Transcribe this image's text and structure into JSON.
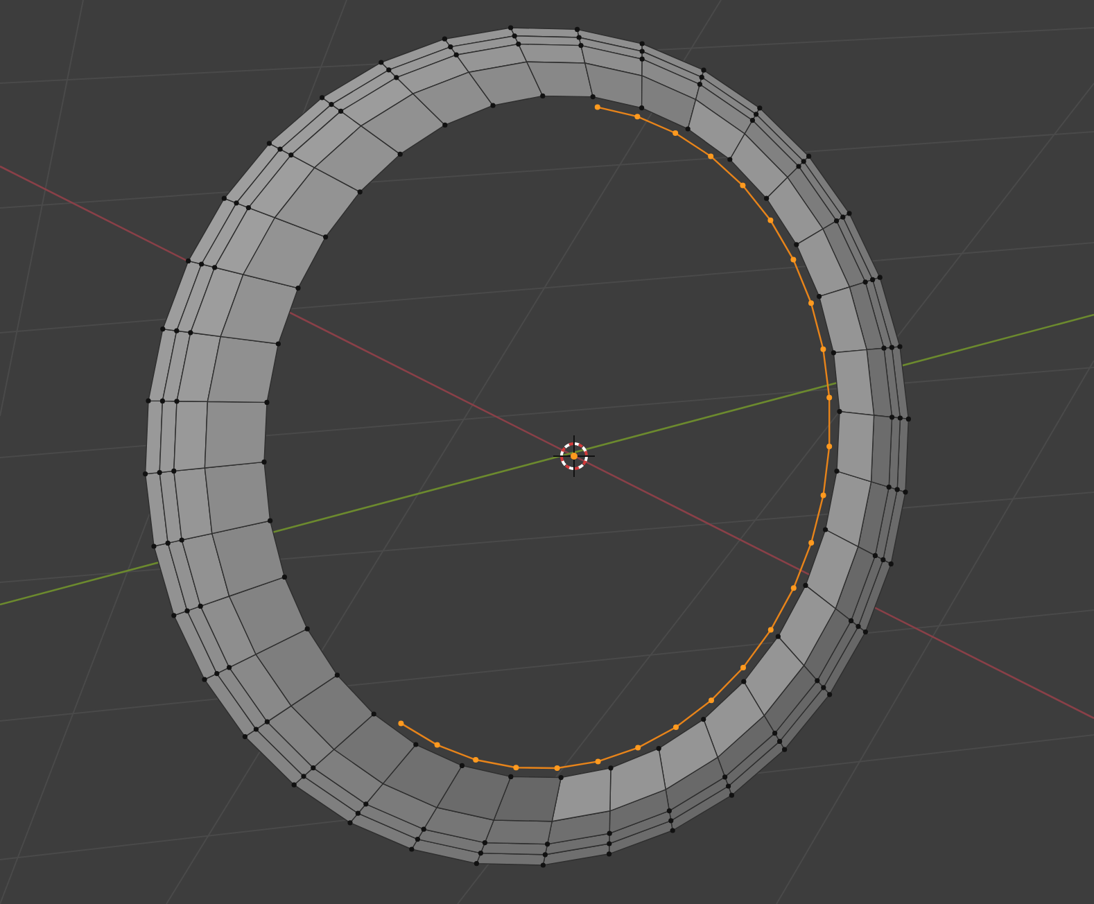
{
  "viewport": {
    "edge_loop_selected": true
  }
}
